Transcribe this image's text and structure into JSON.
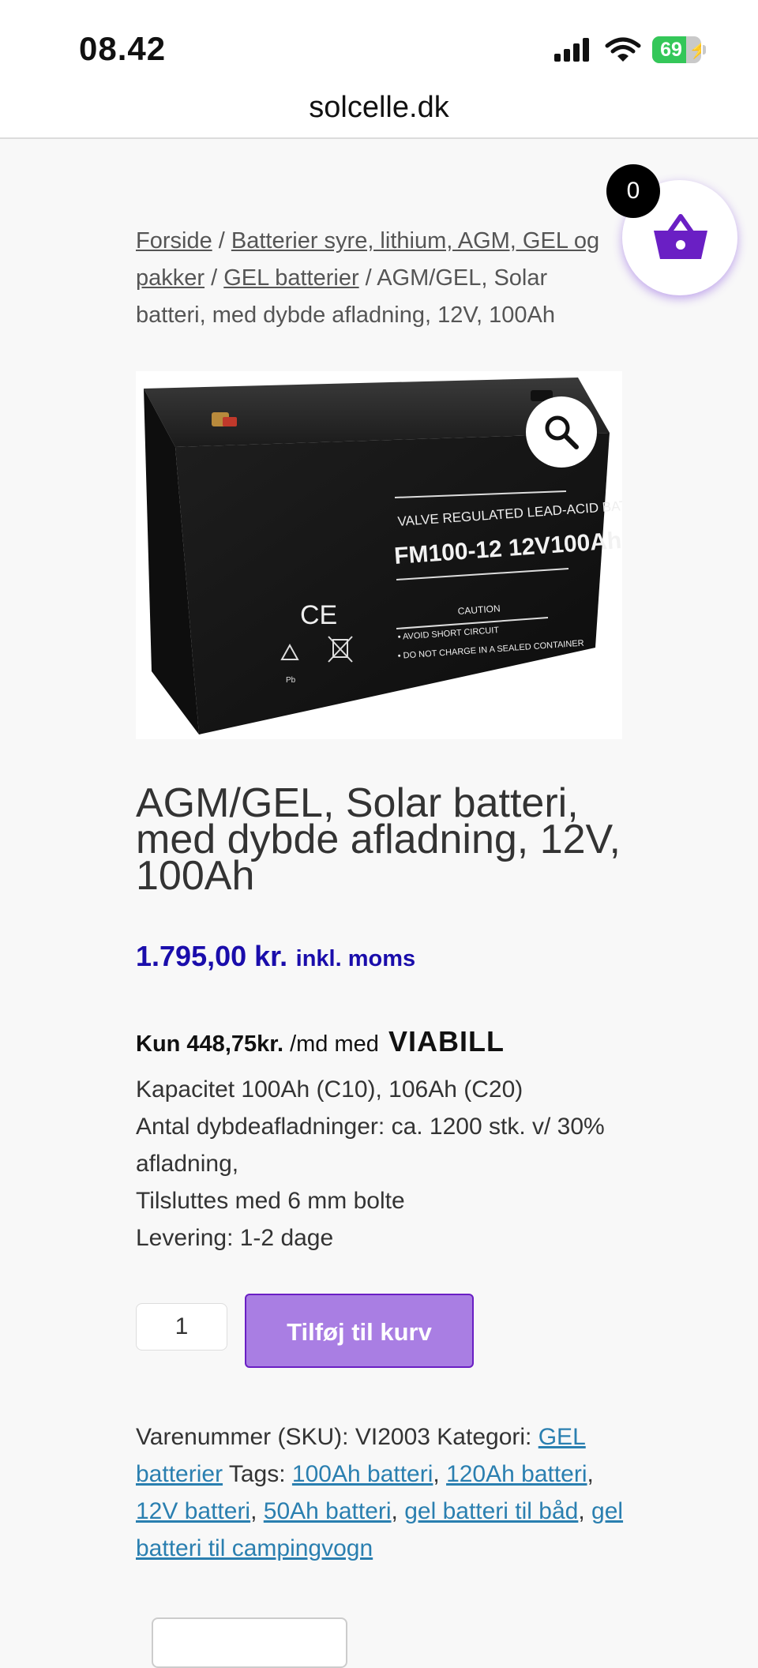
{
  "status_bar": {
    "time": "08.42",
    "battery_level": "69",
    "battery_fraction": 0.69
  },
  "browser": {
    "url": "solcelle.dk"
  },
  "cart": {
    "count": "0",
    "accent_color": "#6a1fc4"
  },
  "breadcrumb": {
    "items": [
      "Forside",
      "Batterier syre, lithium, AGM, GEL og pakker",
      "GEL batterier"
    ],
    "separator": " / ",
    "current": "AGM/GEL, Solar batteri, med dybde afladning, 12V, 100Ah"
  },
  "product_image": {
    "line1": "VALVE REGULATED LEAD-ACID BATTERY",
    "model": "FM100-12  12V100Ah",
    "ce": "CE",
    "caution": "CAUTION",
    "warn1": "• AVOID SHORT CIRCUIT",
    "warn2": "• DO NOT CHARGE IN A SEALED CONTAINER",
    "pb": "Pb"
  },
  "product": {
    "title": "AGM/GEL, Solar batteri, med dybde afladning, 12V, 100Ah",
    "price": "1.795,00 kr.",
    "price_suffix": "inkl. moms",
    "viabill_amount": "Kun 448,75kr.",
    "viabill_text": "/md med",
    "viabill_logo": "VIABILL",
    "description": [
      "Kapacitet 100Ah (C10), 106Ah (C20)",
      "Antal dybdeafladninger: ca. 1200 stk. v/ 30% afladning,",
      "Tilsluttes med 6 mm bolte",
      "Levering: 1-2 dage"
    ]
  },
  "purchase": {
    "quantity": "1",
    "add_to_cart_label": "Tilføj til kurv"
  },
  "meta": {
    "sku_label": "Varenummer (SKU):",
    "sku": "VI2003",
    "category_label": "Kategori:",
    "category": "GEL batterier",
    "tags_label": "Tags:",
    "tags": [
      "100Ah batteri",
      "120Ah batteri",
      "12V batteri",
      "50Ah batteri",
      "gel batteri til båd",
      "gel batteri til campingvogn"
    ]
  }
}
